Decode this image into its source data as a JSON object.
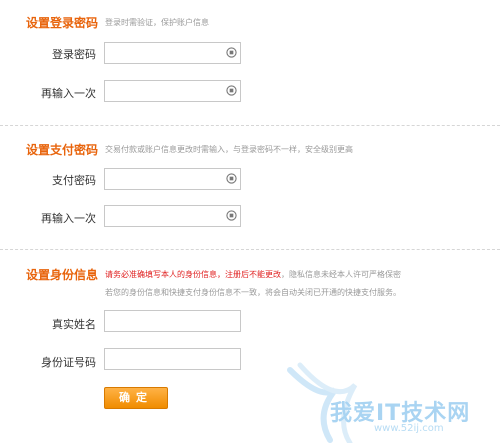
{
  "login": {
    "title": "设置登录密码",
    "hint": "登录时需验证，保护账户信息",
    "password_label": "登录密码",
    "repeat_label": "再输入一次",
    "password_value": "",
    "repeat_value": ""
  },
  "pay": {
    "title": "设置支付密码",
    "hint": "交易付款或账户信息更改时需输入，与登录密码不一样，安全级别更高",
    "password_label": "支付密码",
    "repeat_label": "再输入一次",
    "password_value": "",
    "repeat_value": ""
  },
  "identity": {
    "title": "设置身份信息",
    "hint_warning": "请务必准确填写本人的身份信息，注册后不能更改",
    "hint_rest": "，隐私信息未经本人许可严格保密",
    "hint_line2": "若您的身份信息和快捷支付身份信息不一致，将会自动关闭已开通的快捷支付服务。",
    "name_label": "真实姓名",
    "id_label": "身份证号码",
    "name_value": "",
    "id_value": ""
  },
  "confirm_label": "确定",
  "watermark": {
    "text": "我爱IT技术网",
    "url": "www.52ij.com"
  },
  "colors": {
    "accent": "#e8640c",
    "button": "#f08c00",
    "warning": "#e02020"
  },
  "icons": {
    "keyboard": "soft-keyboard-icon"
  }
}
